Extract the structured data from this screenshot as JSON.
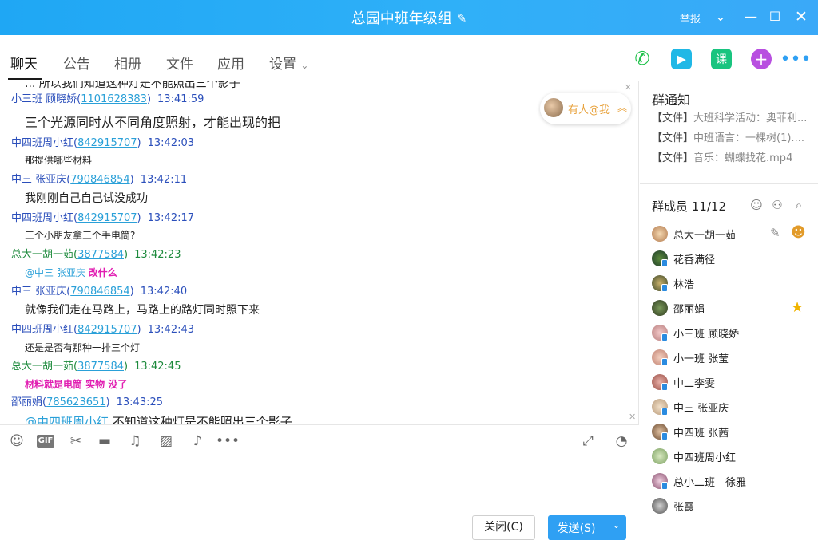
{
  "window": {
    "title": "总园中班年级组",
    "report": "举报"
  },
  "tabs": [
    "聊天",
    "公告",
    "相册",
    "文件",
    "应用",
    "设置"
  ],
  "messages": [
    {
      "name": "小三班 顾晓娇",
      "qq": "1101628383",
      "time": "13:41:59",
      "text": "三个光源同时从不同角度照射，才能出现的把",
      "style": "big",
      "headColor": "#2b4fbb"
    },
    {
      "name": "中四班周小红",
      "qq": "842915707",
      "time": "13:42:03",
      "text": "那提供哪些材料",
      "style": "small",
      "headColor": "#2b4fbb"
    },
    {
      "name": "中三 张亚庆",
      "qq": "790846854",
      "time": "13:42:11",
      "text": "我刚刚自己自己试没成功",
      "style": "medium",
      "headColor": "#2b4fbb"
    },
    {
      "name": "中四班周小红",
      "qq": "842915707",
      "time": "13:42:17",
      "text": "三个小朋友拿三个手电筒?",
      "style": "small",
      "headColor": "#2b4fbb"
    },
    {
      "name": "总大一胡一茹",
      "qq": "3877584",
      "time": "13:42:23",
      "mention": "@中三 张亚庆",
      "text": "改什么",
      "style": "mention",
      "headColor": "#1d8a3c"
    },
    {
      "name": "中三 张亚庆",
      "qq": "790846854",
      "time": "13:42:40",
      "text": "就像我们走在马路上，马路上的路灯同时照下来",
      "style": "medium",
      "headColor": "#2b4fbb"
    },
    {
      "name": "中四班周小红",
      "qq": "842915707",
      "time": "13:42:43",
      "text": "还是是否有那种一排三个灯",
      "style": "small",
      "headColor": "#2b4fbb"
    },
    {
      "name": "总大一胡一茹",
      "qq": "3877584",
      "time": "13:42:45",
      "text": "材料就是电筒 实物 没了",
      "style": "pink",
      "headColor": "#1d8a3c"
    },
    {
      "name": "邵丽娟",
      "qq": "785623651",
      "time": "13:43:25",
      "mention": "@中四班周小红",
      "text": "不知道这种灯是不能照出三个影子",
      "style": "mentionbig",
      "headColor": "#2b4fbb"
    }
  ],
  "top_partial": "... 所以我们知道这种灯是不能照出三个影子",
  "mention_pill": "有人@我",
  "buttons": {
    "close": "关闭(C)",
    "send": "发送(S)"
  },
  "notice": {
    "title": "群通知",
    "items": [
      {
        "tag": "【文件】",
        "text": "大班科学活动：奥菲利..."
      },
      {
        "tag": "【文件】",
        "text": "中班语言：一棵树(1)...."
      },
      {
        "tag": "【文件】",
        "text": "音乐：蝴蝶找花.mp4"
      }
    ]
  },
  "members": {
    "title": "群成员 11/12",
    "list": [
      "总大一胡一茹",
      "花香满径",
      "林浩",
      "邵丽娟",
      "小三班 顾晓娇",
      "小一班 张莹",
      "中二李雯",
      "中三 张亚庆",
      "中四班 张茜",
      "中四班周小红",
      "总小二班　徐雅",
      "张霞"
    ]
  },
  "colors": {
    "accent": "#2fa0f3",
    "titlebar": "#2aabf6",
    "mention": "#2aa0d8",
    "pink": "#e11fb2"
  }
}
